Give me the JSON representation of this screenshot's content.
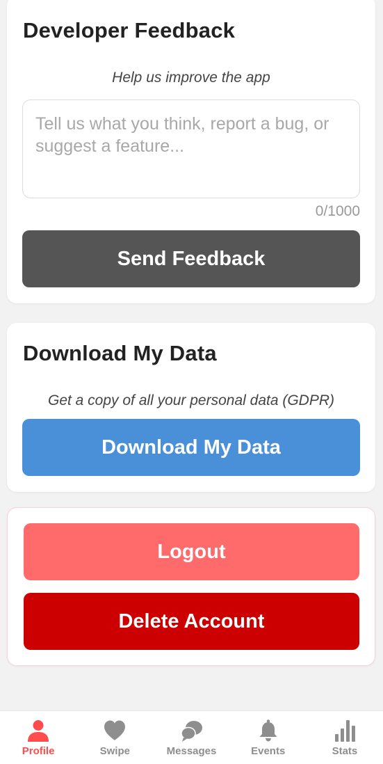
{
  "feedback": {
    "title": "Developer Feedback",
    "subtitle": "Help us improve the app",
    "input_value": "",
    "input_placeholder": "Tell us what you think, report a bug, or suggest a feature...",
    "char_count": "0/1000",
    "send_label": "Send Feedback"
  },
  "download": {
    "title": "Download My Data",
    "subtitle": "Get a copy of all your personal data (GDPR)",
    "button_label": "Download My Data"
  },
  "account": {
    "logout_label": "Logout",
    "delete_label": "Delete Account"
  },
  "tabbar": {
    "active_color": "#ff4d4d",
    "inactive_color": "#8e8e8e",
    "tabs": [
      {
        "label": "Profile",
        "icon": "person-icon",
        "active": true
      },
      {
        "label": "Swipe",
        "icon": "heart-icon",
        "active": false
      },
      {
        "label": "Messages",
        "icon": "chat-bubbles-icon",
        "active": false
      },
      {
        "label": "Events",
        "icon": "bell-icon",
        "active": false
      },
      {
        "label": "Stats",
        "icon": "bar-chart-icon",
        "active": false
      }
    ]
  },
  "colors": {
    "send_button": "#555555",
    "download_button": "#4a90d9",
    "logout_button": "#ff6b6b",
    "delete_button": "#cc0000"
  }
}
